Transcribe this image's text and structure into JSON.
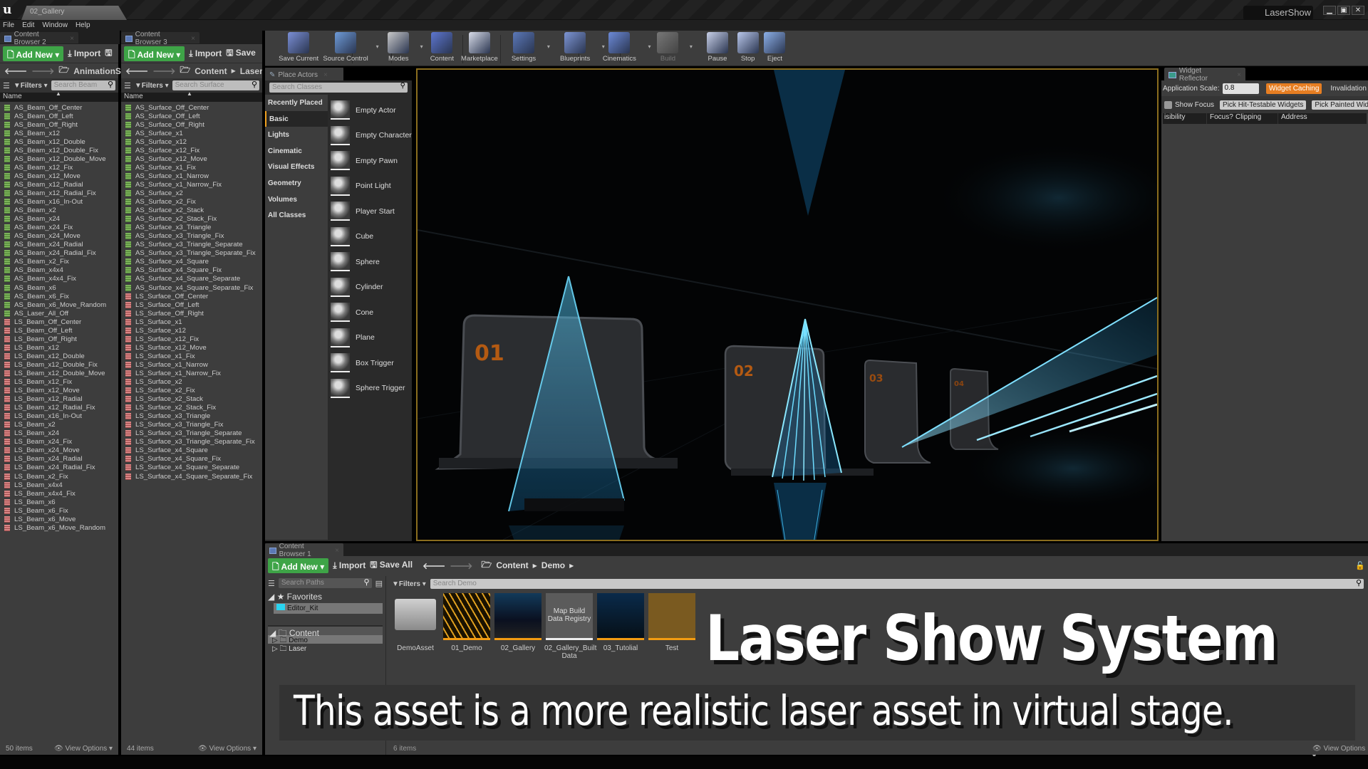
{
  "window": {
    "doc_tab": "02_Gallery",
    "project_name": "LaserShow",
    "controls": [
      "minimize",
      "restore",
      "close"
    ]
  },
  "menu": [
    "File",
    "Edit",
    "Window",
    "Help"
  ],
  "content_browser_2": {
    "tab": "Content Browser 2",
    "add_new": "Add New",
    "import": "Import",
    "path": [
      "AnimationSEQ"
    ],
    "filters": "Filters",
    "search_placeholder": "Search Beam",
    "column": "Name",
    "items": [
      {
        "name": "AS_Beam_Off_Center",
        "type": "AS"
      },
      {
        "name": "AS_Beam_Off_Left",
        "type": "AS"
      },
      {
        "name": "AS_Beam_Off_Right",
        "type": "AS"
      },
      {
        "name": "AS_Beam_x12",
        "type": "AS"
      },
      {
        "name": "AS_Beam_x12_Double",
        "type": "AS"
      },
      {
        "name": "AS_Beam_x12_Double_Fix",
        "type": "AS"
      },
      {
        "name": "AS_Beam_x12_Double_Move",
        "type": "AS"
      },
      {
        "name": "AS_Beam_x12_Fix",
        "type": "AS"
      },
      {
        "name": "AS_Beam_x12_Move",
        "type": "AS"
      },
      {
        "name": "AS_Beam_x12_Radial",
        "type": "AS"
      },
      {
        "name": "AS_Beam_x12_Radial_Fix",
        "type": "AS"
      },
      {
        "name": "AS_Beam_x16_In-Out",
        "type": "AS"
      },
      {
        "name": "AS_Beam_x2",
        "type": "AS"
      },
      {
        "name": "AS_Beam_x24",
        "type": "AS"
      },
      {
        "name": "AS_Beam_x24_Fix",
        "type": "AS"
      },
      {
        "name": "AS_Beam_x24_Move",
        "type": "AS"
      },
      {
        "name": "AS_Beam_x24_Radial",
        "type": "AS"
      },
      {
        "name": "AS_Beam_x24_Radial_Fix",
        "type": "AS"
      },
      {
        "name": "AS_Beam_x2_Fix",
        "type": "AS"
      },
      {
        "name": "AS_Beam_x4x4",
        "type": "AS"
      },
      {
        "name": "AS_Beam_x4x4_Fix",
        "type": "AS"
      },
      {
        "name": "AS_Beam_x6",
        "type": "AS"
      },
      {
        "name": "AS_Beam_x6_Fix",
        "type": "AS"
      },
      {
        "name": "AS_Beam_x6_Move_Random",
        "type": "AS"
      },
      {
        "name": "AS_Laser_All_Off",
        "type": "AS"
      },
      {
        "name": "LS_Beam_Off_Center",
        "type": "LS"
      },
      {
        "name": "LS_Beam_Off_Left",
        "type": "LS"
      },
      {
        "name": "LS_Beam_Off_Right",
        "type": "LS"
      },
      {
        "name": "LS_Beam_x12",
        "type": "LS"
      },
      {
        "name": "LS_Beam_x12_Double",
        "type": "LS"
      },
      {
        "name": "LS_Beam_x12_Double_Fix",
        "type": "LS"
      },
      {
        "name": "LS_Beam_x12_Double_Move",
        "type": "LS"
      },
      {
        "name": "LS_Beam_x12_Fix",
        "type": "LS"
      },
      {
        "name": "LS_Beam_x12_Move",
        "type": "LS"
      },
      {
        "name": "LS_Beam_x12_Radial",
        "type": "LS"
      },
      {
        "name": "LS_Beam_x12_Radial_Fix",
        "type": "LS"
      },
      {
        "name": "LS_Beam_x16_In-Out",
        "type": "LS"
      },
      {
        "name": "LS_Beam_x2",
        "type": "LS"
      },
      {
        "name": "LS_Beam_x24",
        "type": "LS"
      },
      {
        "name": "LS_Beam_x24_Fix",
        "type": "LS"
      },
      {
        "name": "LS_Beam_x24_Move",
        "type": "LS"
      },
      {
        "name": "LS_Beam_x24_Radial",
        "type": "LS"
      },
      {
        "name": "LS_Beam_x24_Radial_Fix",
        "type": "LS"
      },
      {
        "name": "LS_Beam_x2_Fix",
        "type": "LS"
      },
      {
        "name": "LS_Beam_x4x4",
        "type": "LS"
      },
      {
        "name": "LS_Beam_x4x4_Fix",
        "type": "LS"
      },
      {
        "name": "LS_Beam_x6",
        "type": "LS"
      },
      {
        "name": "LS_Beam_x6_Fix",
        "type": "LS"
      },
      {
        "name": "LS_Beam_x6_Move",
        "type": "LS"
      },
      {
        "name": "LS_Beam_x6_Move_Random",
        "type": "LS"
      }
    ],
    "count": "50 items",
    "view_options": "View Options"
  },
  "content_browser_3": {
    "tab": "Content Browser 3",
    "add_new": "Add New",
    "import": "Import",
    "save": "Save",
    "path": [
      "Content",
      "Laser"
    ],
    "filters": "Filters",
    "search_placeholder": "Search Surface",
    "column": "Name",
    "items": [
      {
        "name": "AS_Surface_Off_Center",
        "type": "AS"
      },
      {
        "name": "AS_Surface_Off_Left",
        "type": "AS"
      },
      {
        "name": "AS_Surface_Off_Right",
        "type": "AS"
      },
      {
        "name": "AS_Surface_x1",
        "type": "AS"
      },
      {
        "name": "AS_Surface_x12",
        "type": "AS"
      },
      {
        "name": "AS_Surface_x12_Fix",
        "type": "AS"
      },
      {
        "name": "AS_Surface_x12_Move",
        "type": "AS"
      },
      {
        "name": "AS_Surface_x1_Fix",
        "type": "AS"
      },
      {
        "name": "AS_Surface_x1_Narrow",
        "type": "AS"
      },
      {
        "name": "AS_Surface_x1_Narrow_Fix",
        "type": "AS"
      },
      {
        "name": "AS_Surface_x2",
        "type": "AS"
      },
      {
        "name": "AS_Surface_x2_Fix",
        "type": "AS"
      },
      {
        "name": "AS_Surface_x2_Stack",
        "type": "AS"
      },
      {
        "name": "AS_Surface_x2_Stack_Fix",
        "type": "AS"
      },
      {
        "name": "AS_Surface_x3_Triangle",
        "type": "AS"
      },
      {
        "name": "AS_Surface_x3_Triangle_Fix",
        "type": "AS"
      },
      {
        "name": "AS_Surface_x3_Triangle_Separate",
        "type": "AS"
      },
      {
        "name": "AS_Surface_x3_Triangle_Separate_Fix",
        "type": "AS"
      },
      {
        "name": "AS_Surface_x4_Square",
        "type": "AS"
      },
      {
        "name": "AS_Surface_x4_Square_Fix",
        "type": "AS"
      },
      {
        "name": "AS_Surface_x4_Square_Separate",
        "type": "AS"
      },
      {
        "name": "AS_Surface_x4_Square_Separate_Fix",
        "type": "AS"
      },
      {
        "name": "LS_Surface_Off_Center",
        "type": "LS"
      },
      {
        "name": "LS_Surface_Off_Left",
        "type": "LS"
      },
      {
        "name": "LS_Surface_Off_Right",
        "type": "LS"
      },
      {
        "name": "LS_Surface_x1",
        "type": "LS"
      },
      {
        "name": "LS_Surface_x12",
        "type": "LS"
      },
      {
        "name": "LS_Surface_x12_Fix",
        "type": "LS"
      },
      {
        "name": "LS_Surface_x12_Move",
        "type": "LS"
      },
      {
        "name": "LS_Surface_x1_Fix",
        "type": "LS"
      },
      {
        "name": "LS_Surface_x1_Narrow",
        "type": "LS"
      },
      {
        "name": "LS_Surface_x1_Narrow_Fix",
        "type": "LS"
      },
      {
        "name": "LS_Surface_x2",
        "type": "LS"
      },
      {
        "name": "LS_Surface_x2_Fix",
        "type": "LS"
      },
      {
        "name": "LS_Surface_x2_Stack",
        "type": "LS"
      },
      {
        "name": "LS_Surface_x2_Stack_Fix",
        "type": "LS"
      },
      {
        "name": "LS_Surface_x3_Triangle",
        "type": "LS"
      },
      {
        "name": "LS_Surface_x3_Triangle_Fix",
        "type": "LS"
      },
      {
        "name": "LS_Surface_x3_Triangle_Separate",
        "type": "LS"
      },
      {
        "name": "LS_Surface_x3_Triangle_Separate_Fix",
        "type": "LS"
      },
      {
        "name": "LS_Surface_x4_Square",
        "type": "LS"
      },
      {
        "name": "LS_Surface_x4_Square_Fix",
        "type": "LS"
      },
      {
        "name": "LS_Surface_x4_Square_Separate",
        "type": "LS"
      },
      {
        "name": "LS_Surface_x4_Square_Separate_Fix",
        "type": "LS"
      }
    ],
    "count": "44 items",
    "view_options": "View Options"
  },
  "toolbar": [
    {
      "label": "Save Current",
      "icon": "save-icon",
      "color": "#7b8fd6",
      "dropdown": false
    },
    {
      "label": "Source Control",
      "icon": "source-control-icon",
      "color": "#6e9bd8",
      "dropdown": true
    },
    {
      "label": "Modes",
      "icon": "modes-icon",
      "color": "#c9c9c9",
      "dropdown": true
    },
    {
      "label": "Content",
      "icon": "content-icon",
      "color": "#5d76d0",
      "dropdown": false
    },
    {
      "label": "Marketplace",
      "icon": "marketplace-icon",
      "color": "#d8dce8",
      "dropdown": false
    },
    {
      "label": "Settings",
      "icon": "settings-icon",
      "color": "#5b78b8",
      "dropdown": true
    },
    {
      "label": "Blueprints",
      "icon": "blueprints-icon",
      "color": "#7d95d4",
      "dropdown": true
    },
    {
      "label": "Cinematics",
      "icon": "cinematics-icon",
      "color": "#6c8ad8",
      "dropdown": true
    },
    {
      "label": "Build",
      "icon": "build-icon",
      "color": "#6b6b6b",
      "dropdown": true,
      "disabled": true
    },
    {
      "label": "Pause",
      "icon": "pause-icon",
      "color": "#c8d0e8",
      "dropdown": false
    },
    {
      "label": "Stop",
      "icon": "stop-icon",
      "color": "#b9c7ea",
      "dropdown": false
    },
    {
      "label": "Eject",
      "icon": "eject-icon",
      "color": "#8cb0e8",
      "dropdown": false
    }
  ],
  "place_actors": {
    "tab": "Place Actors",
    "search_placeholder": "Search Classes",
    "categories": [
      "Recently Placed",
      "Basic",
      "Lights",
      "Cinematic",
      "Visual Effects",
      "Geometry",
      "Volumes",
      "All Classes"
    ],
    "active_category": "Basic",
    "actors": [
      "Empty Actor",
      "Empty Character",
      "Empty Pawn",
      "Point Light",
      "Player Start",
      "Cube",
      "Sphere",
      "Cylinder",
      "Cone",
      "Plane",
      "Box Trigger",
      "Sphere Trigger"
    ]
  },
  "viewport": {
    "stand_labels": [
      "01",
      "02",
      "03",
      "04"
    ],
    "accent": "#f39c12",
    "laser_color": "#3cc8ff"
  },
  "widget_reflector": {
    "tab": "Widget Reflector",
    "app_scale_label": "Application Scale:",
    "app_scale_value": "0.8",
    "widget_caching": "Widget Caching",
    "invalidation": "Invalidation",
    "show_focus": "Show Focus",
    "show_focus_checked": false,
    "pick_hit_testable": "Pick Hit-Testable Widgets",
    "pick_painted": "Pick Painted Widgets",
    "columns": [
      "isibility",
      "Focus?",
      "Clipping",
      "Address"
    ]
  },
  "content_browser_1": {
    "tab": "Content Browser 1",
    "add_new": "Add New",
    "import": "Import",
    "save_all": "Save All",
    "path": [
      "Content",
      "Demo"
    ],
    "search_paths_placeholder": "Search Paths",
    "favorites_label": "Favorites",
    "favorites": [
      "Editor_Kit"
    ],
    "tree_root": "Content",
    "tree": [
      "Demo",
      "Laser"
    ],
    "selected_folder": "Demo",
    "filters": "Filters",
    "search_placeholder": "Search Demo",
    "assets": [
      {
        "name": "DemoAsset",
        "kind": "folder"
      },
      {
        "name": "01_Demo",
        "kind": "map"
      },
      {
        "name": "02_Gallery",
        "kind": "map"
      },
      {
        "name": "02_Gallery_Built Data",
        "kind": "registry",
        "thumb_text": "Map Build Data Registry"
      },
      {
        "name": "03_Tutolial",
        "kind": "map"
      },
      {
        "name": "Test",
        "kind": "mesh"
      }
    ],
    "count": "6 items",
    "view_options": "View Options"
  },
  "overlay": {
    "headline": "Laser Show System",
    "subline": "This asset is a more realistic laser asset in virtual stage."
  }
}
